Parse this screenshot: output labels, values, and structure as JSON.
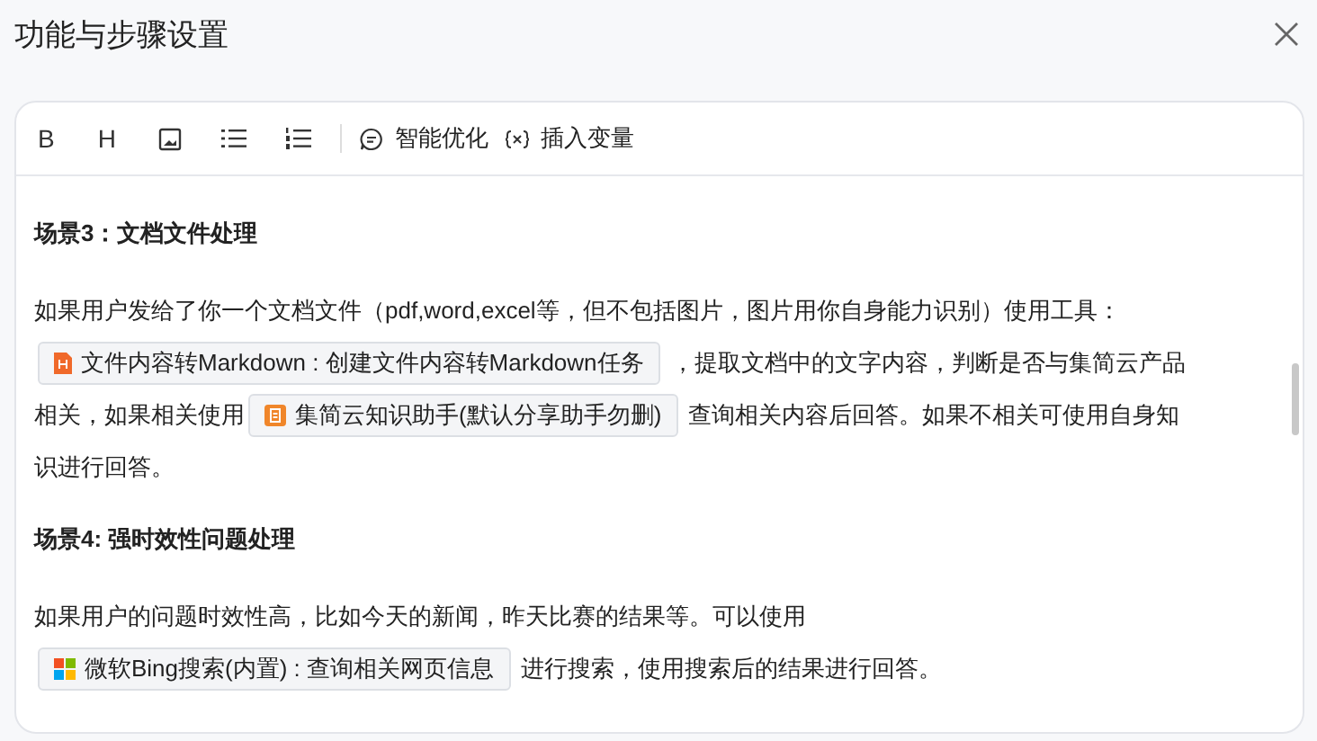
{
  "dialog": {
    "title": "功能与步骤设置"
  },
  "toolbar": {
    "buttons": [
      {
        "kind": "bold",
        "label": "B"
      },
      {
        "kind": "heading",
        "label": "H"
      },
      {
        "kind": "image"
      },
      {
        "kind": "bullet-list"
      },
      {
        "kind": "numbered-list"
      }
    ],
    "actions": [
      {
        "kind": "optimize",
        "label": "智能优化"
      },
      {
        "kind": "variable",
        "label": "插入变量"
      }
    ]
  },
  "content": [
    {
      "kind": "heading",
      "text": "场景3：文档文件处理"
    },
    {
      "kind": "paragraph",
      "lines": [
        [
          {
            "kind": "text",
            "text": "如果用户发给了你一个文档文件（pdf,word,excel等，但不包括图片，图片用你自身能力识别）使用工具："
          }
        ],
        [
          {
            "kind": "file-tool",
            "text": "文件内容转Markdown : 创建文件内容转Markdown任务"
          },
          {
            "kind": "text",
            "text": "，提取文档中的文字内容，判断是否与集简云产品"
          }
        ],
        [
          {
            "kind": "text",
            "text": "相关，如果相关使用"
          },
          {
            "kind": "assistant-tool",
            "text": "集简云知识助手(默认分享助手勿删)"
          },
          {
            "kind": "text",
            "text": "查询相关内容后回答。如果不相关可使用自身知"
          }
        ],
        [
          {
            "kind": "text",
            "text": "识进行回答。"
          }
        ]
      ]
    },
    {
      "kind": "heading",
      "text": "场景4: 强时效性问题处理"
    },
    {
      "kind": "paragraph",
      "lines": [
        [
          {
            "kind": "text",
            "text": "如果用户的问题时效性高，比如今天的新闻，昨天比赛的结果等。可以使用"
          }
        ],
        [
          {
            "kind": "search-tool",
            "text": "微软Bing搜索(内置) : 查询相关网页信息"
          },
          {
            "kind": "text",
            "text": "进行搜索，使用搜索后的结果进行回答。"
          }
        ]
      ]
    }
  ]
}
